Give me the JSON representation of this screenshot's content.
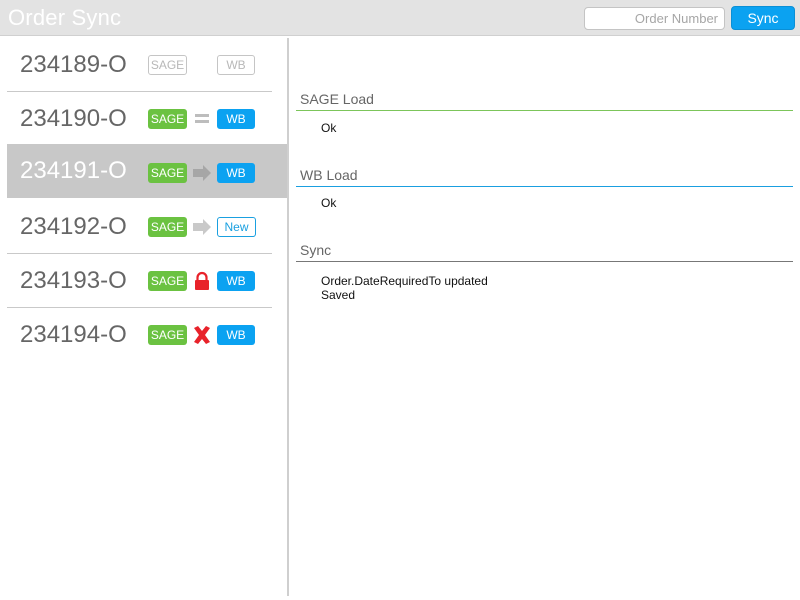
{
  "header": {
    "title": "Order Sync",
    "search_placeholder": "Order Number",
    "sync_label": "Sync"
  },
  "orders": [
    {
      "id": "234189-O",
      "sage_label": "SAGE",
      "wb_label": "WB",
      "status": "none",
      "selected": false
    },
    {
      "id": "234190-O",
      "sage_label": "SAGE",
      "wb_label": "WB",
      "status": "equal-icon",
      "selected": false
    },
    {
      "id": "234191-O",
      "sage_label": "SAGE",
      "wb_label": "WB",
      "status": "arrow-right-icon",
      "selected": true
    },
    {
      "id": "234192-O",
      "sage_label": "SAGE",
      "wb_label": "New",
      "status": "arrow-right-icon",
      "selected": false
    },
    {
      "id": "234193-O",
      "sage_label": "SAGE",
      "wb_label": "WB",
      "status": "lock-icon",
      "selected": false
    },
    {
      "id": "234194-O",
      "sage_label": "SAGE",
      "wb_label": "WB",
      "status": "error-x-icon",
      "selected": false
    }
  ],
  "details": {
    "sage_load": {
      "title": "SAGE Load",
      "messages": [
        "Ok"
      ]
    },
    "wb_load": {
      "title": "WB Load",
      "messages": [
        "Ok"
      ]
    },
    "sync": {
      "title": "Sync",
      "messages": [
        "Order.DateRequiredTo updated",
        "Saved"
      ]
    }
  },
  "colors": {
    "sage_green": "#6bc241",
    "wb_blue": "#0ba2f1",
    "lock_red": "#e8222a",
    "sage_line": "#7cc55a",
    "wb_line": "#1a9fe0",
    "sync_line": "#777777"
  }
}
